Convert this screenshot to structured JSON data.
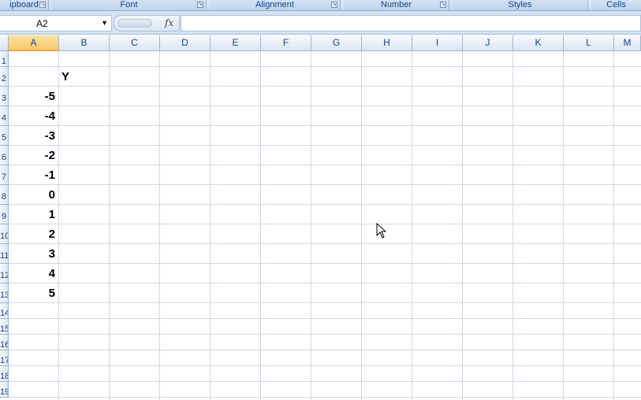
{
  "ribbon": {
    "groups": [
      {
        "label": "ipboard",
        "launcher": true
      },
      {
        "label": "Font",
        "launcher": true
      },
      {
        "label": "Alignment",
        "launcher": true
      },
      {
        "label": "Number",
        "launcher": true
      },
      {
        "label": "Styles",
        "launcher": false
      },
      {
        "label": "Cells",
        "launcher": false
      }
    ]
  },
  "formula_bar": {
    "name_box": "A2",
    "fx_label": "fx",
    "formula": ""
  },
  "columns": [
    "A",
    "B",
    "C",
    "D",
    "E",
    "F",
    "G",
    "H",
    "I",
    "J",
    "K",
    "L",
    "M"
  ],
  "rows": [
    "1",
    "2",
    "3",
    "4",
    "5",
    "6",
    "7",
    "8",
    "9",
    "10",
    "11",
    "12",
    "13",
    "14",
    "15",
    "16",
    "17",
    "18",
    "19"
  ],
  "active_column": "A",
  "cells": {
    "B2": "Y",
    "A3": "-5",
    "A4": "-4",
    "A5": "-3",
    "A6": "-2",
    "A7": "-1",
    "A8": "0",
    "A9": "1",
    "A10": "2",
    "A11": "3",
    "A12": "4",
    "A13": "5"
  }
}
